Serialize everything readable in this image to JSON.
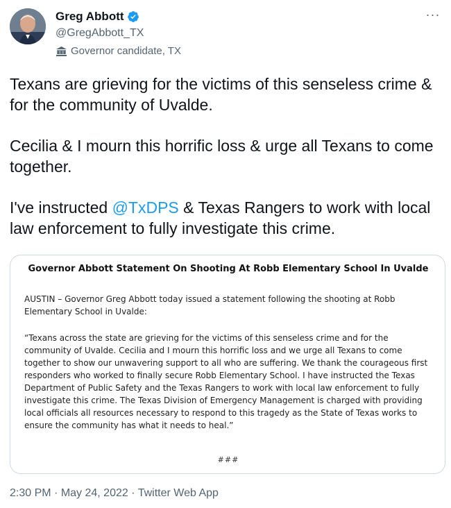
{
  "author": {
    "name": "Greg Abbott",
    "handle": "@GregAbbott_TX",
    "label": "Governor candidate, TX",
    "verified_color": "#1d9bf0"
  },
  "header": {
    "more_icon": "more-horizontal-icon",
    "more_label": "···"
  },
  "tweet": {
    "paragraph1": "Texans are grieving for the victims of this senseless crime & for the community of Uvalde.",
    "paragraph2": "Cecilia & I mourn this horrific loss & urge all Texans to come together.",
    "paragraph3_before": "I've instructed ",
    "mention": "@TxDPS",
    "paragraph3_after": " & Texas Rangers to work with local law enforcement to fully investigate this crime."
  },
  "attachment": {
    "title": "Governor Abbott Statement On Shooting At Robb Elementary School In Uvalde",
    "intro": "AUSTIN – Governor Greg Abbott today issued a statement following the shooting at Robb Elementary School in Uvalde:",
    "quote": "“Texans across the state are grieving for the victims of this senseless crime and for the community of Uvalde. Cecilia and I mourn this horrific loss and we urge all Texans to come together to show our unwavering support to all who are suffering. We thank the courageous first responders who worked to finally secure Robb Elementary School. I have instructed the Texas Department of Public Safety and the Texas Rangers to work with local law enforcement to fully investigate this crime. The Texas Division of Emergency Management is charged with providing local officials all resources necessary to respond to this tragedy as the State of Texas works to ensure the community has what it needs to heal.”",
    "end_mark": "###"
  },
  "meta": {
    "time": "2:30 PM",
    "separator": " · ",
    "date": "May 24, 2022",
    "source": "Twitter Web App"
  },
  "colors": {
    "text": "#0f1419",
    "secondary": "#536471",
    "link": "#1d9bf0",
    "border": "#cfd9de"
  }
}
